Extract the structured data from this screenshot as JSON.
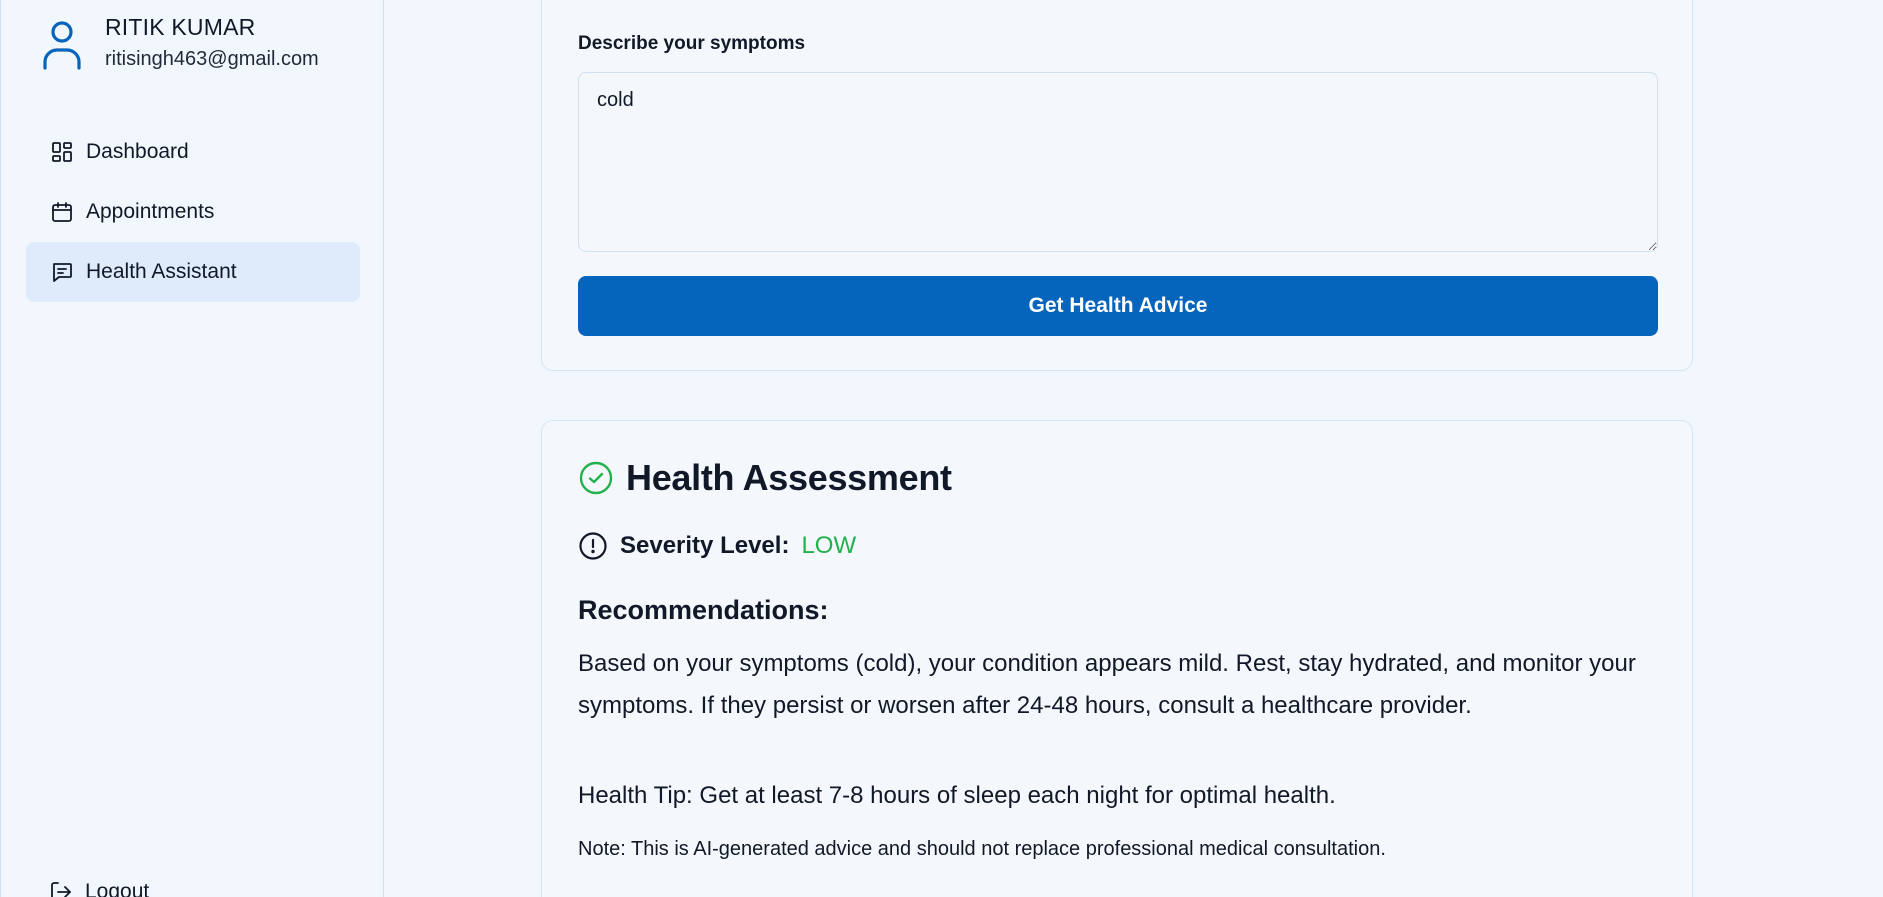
{
  "user": {
    "name": "RITIK KUMAR",
    "email": "ritisingh463@gmail.com"
  },
  "sidebar": {
    "items": [
      {
        "label": "Dashboard",
        "icon": "dashboard-icon",
        "active": false
      },
      {
        "label": "Appointments",
        "icon": "calendar-icon",
        "active": false
      },
      {
        "label": "Health Assistant",
        "icon": "message-icon",
        "active": true
      }
    ],
    "logout_label": "Logout"
  },
  "symptoms": {
    "label": "Describe your symptoms",
    "value": "cold",
    "button_label": "Get Health Advice"
  },
  "assessment": {
    "title": "Health Assessment",
    "severity_label": "Severity Level:",
    "severity_value": "LOW",
    "recommendations_title": "Recommendations:",
    "recommendation": "Based on your symptoms (cold), your condition appears mild. Rest, stay hydrated, and monitor your symptoms. If they persist or worsen after 24-48 hours, consult a healthcare provider.",
    "health_tip": "Health Tip: Get at least 7-8 hours of sleep each night for optimal health.",
    "note": "Note: This is AI-generated advice and should not replace professional medical consultation."
  },
  "colors": {
    "accent": "#0564bc",
    "severity_low": "#22b14c",
    "background": "#f2f7fd",
    "active_nav": "#deebfb"
  }
}
